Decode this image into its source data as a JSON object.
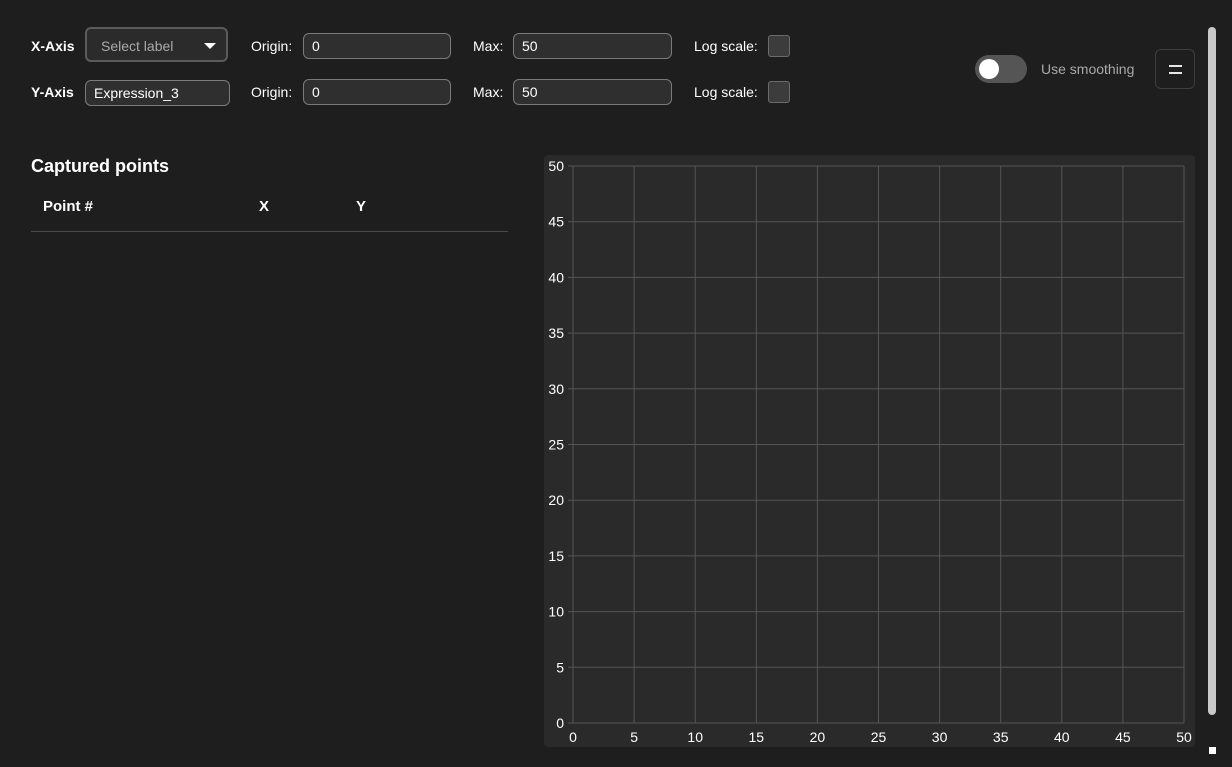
{
  "x_axis": {
    "label": "X-Axis",
    "select_placeholder": "Select label",
    "origin_label": "Origin:",
    "origin_value": "0",
    "max_label": "Max:",
    "max_value": "50",
    "log_label": "Log scale:",
    "log_checked": false
  },
  "y_axis": {
    "label": "Y-Axis",
    "expression_value": "Expression_3",
    "origin_label": "Origin:",
    "origin_value": "0",
    "max_label": "Max:",
    "max_value": "50",
    "log_label": "Log scale:",
    "log_checked": false
  },
  "smoothing": {
    "label": "Use smoothing",
    "enabled": false
  },
  "menu": {
    "icon": "menu-icon"
  },
  "captured": {
    "title": "Captured points",
    "columns": [
      "Point #",
      "X",
      "Y"
    ],
    "rows": []
  },
  "colors": {
    "background": "#1e1e1e",
    "plot_background": "#2a2a2a",
    "grid": "#555555",
    "text": "#ffffff"
  },
  "chart_data": {
    "type": "scatter",
    "x": [],
    "y": [],
    "xlim": [
      0,
      50
    ],
    "ylim": [
      0,
      50
    ],
    "x_ticks": [
      "0",
      "5",
      "10",
      "15",
      "20",
      "25",
      "30",
      "35",
      "40",
      "45",
      "50"
    ],
    "y_ticks": [
      "0",
      "5",
      "10",
      "15",
      "20",
      "25",
      "30",
      "35",
      "40",
      "45",
      "50"
    ],
    "grid": true
  }
}
